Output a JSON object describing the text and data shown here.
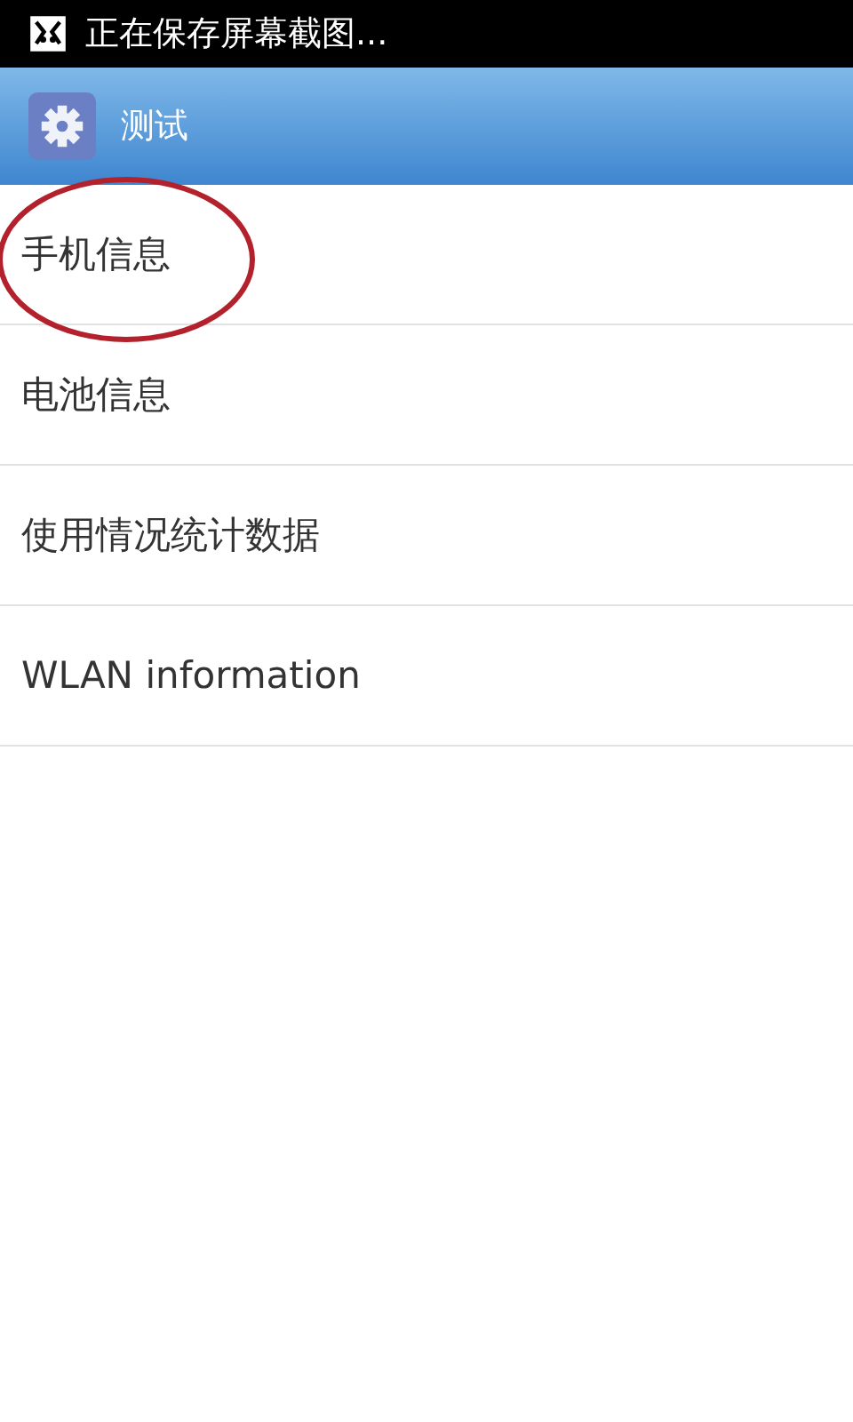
{
  "status_bar": {
    "notification": "正在保存屏幕截图..."
  },
  "action_bar": {
    "title": "测试"
  },
  "items": [
    {
      "label": "手机信息",
      "circled": true
    },
    {
      "label": "电池信息",
      "circled": false
    },
    {
      "label": "使用情况统计数据",
      "circled": false
    },
    {
      "label": "WLAN information",
      "circled": false
    }
  ]
}
